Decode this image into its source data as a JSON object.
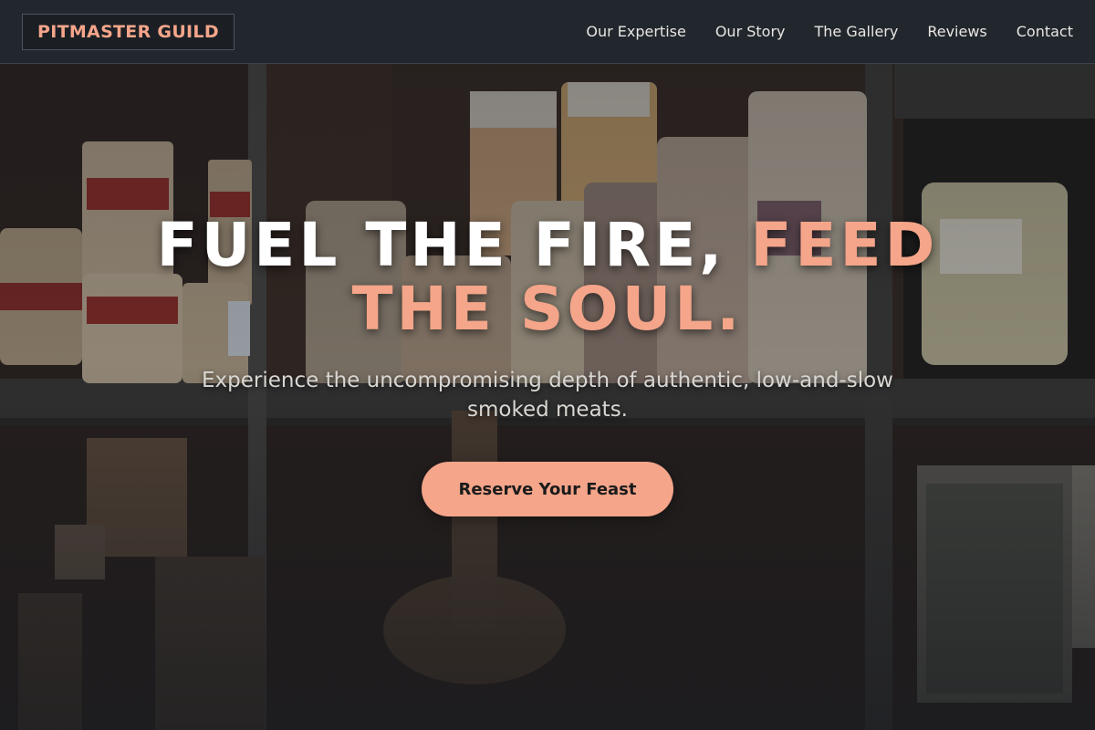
{
  "brand": {
    "name": "PITMASTER GUILD"
  },
  "nav": {
    "items": [
      {
        "label": "Our Expertise"
      },
      {
        "label": "Our Story"
      },
      {
        "label": "The Gallery"
      },
      {
        "label": "Reviews"
      },
      {
        "label": "Contact"
      }
    ]
  },
  "hero": {
    "headline_white": "FUEL THE FIRE, ",
    "headline_accent": "FEED THE SOUL.",
    "subtitle": "Experience the uncompromising depth of authentic, low-and-slow smoked meats.",
    "cta_label": "Reserve Your Feast",
    "background_description_icon": "pantry-shelves-photo"
  },
  "colors": {
    "accent": "#f4a58a",
    "navbar_bg": "#22282e",
    "text_light": "#e8e6e3",
    "cta_text": "#1b1b1b"
  }
}
